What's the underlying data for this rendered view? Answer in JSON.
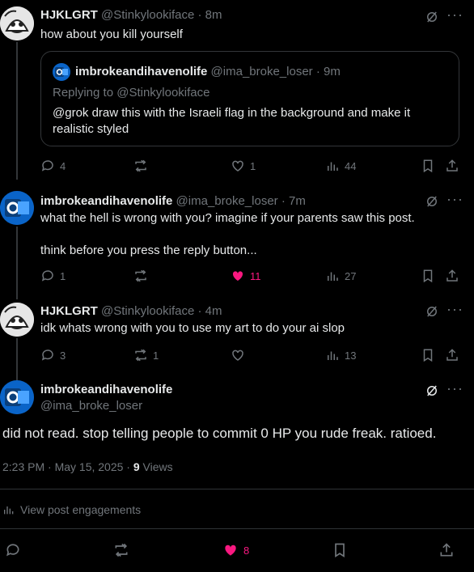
{
  "tweets": [
    {
      "name": "HJKLGRT",
      "handle": "@Stinkylookiface",
      "time": "8m",
      "text": "how about you kill yourself",
      "quote": {
        "name": "imbrokeandihavenolife",
        "handle": "@ima_broke_loser",
        "time": "9m",
        "replying_to": "Replying to @Stinkylookiface",
        "text": "@grok draw this with the Israeli flag in the background and make it realistic styled"
      },
      "stats": {
        "replies": "4",
        "reposts": "",
        "likes": "1",
        "views": "44"
      }
    },
    {
      "name": "imbrokeandihavenolife",
      "handle": "@ima_broke_loser",
      "time": "7m",
      "text": "what the hell is wrong with you? imagine if your parents saw this post.\n\nthink before you press the reply button...",
      "stats": {
        "replies": "1",
        "reposts": "",
        "likes": "11",
        "views": "27"
      }
    },
    {
      "name": "HJKLGRT",
      "handle": "@Stinkylookiface",
      "time": "4m",
      "text": "idk whats wrong with you to use my art to do your ai slop",
      "stats": {
        "replies": "3",
        "reposts": "1",
        "likes": "",
        "views": "13"
      }
    }
  ],
  "main": {
    "name": "imbrokeandihavenolife",
    "handle": "@ima_broke_loser",
    "text": "did not read. stop telling people to commit 0 HP you rude freak. ratioed.",
    "timestamp": "2:23 PM · May 15, 2025 · ",
    "views_count": "9",
    "views_label": " Views",
    "engagements_label": "View post engagements",
    "likes": "8"
  },
  "sep": "·",
  "more_glyph": "···",
  "colors": {
    "background": "#000000",
    "text": "#e7e9ea",
    "muted": "#71767b",
    "like_pink": "#f91880",
    "divider": "#2f3336"
  },
  "icons": [
    "reply-icon",
    "repost-icon",
    "like-icon",
    "views-icon",
    "bookmark-icon",
    "share-icon",
    "grok-icon",
    "more-icon"
  ]
}
